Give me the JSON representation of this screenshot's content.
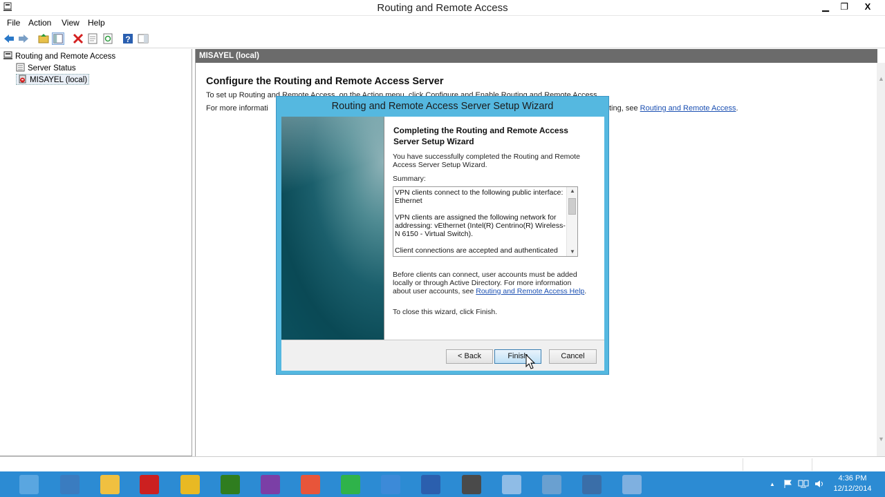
{
  "window": {
    "title": "Routing and Remote Access",
    "minimize": "▁",
    "maximize": "❐",
    "close": "X"
  },
  "menu": [
    "File",
    "Action",
    "View",
    "Help"
  ],
  "tree": {
    "root": "Routing and Remote Access",
    "items": [
      "Server Status",
      "MISAYEL (local)"
    ]
  },
  "main": {
    "header": "MISAYEL (local)",
    "heading": "Configure the Routing and Remote Access Server",
    "line1": "To set up Routing and Remote Access, on the Action menu, click Configure and Enable Routing and Remote Access.",
    "line2_prefix": "For more informati",
    "line2_suffix": "ting, see",
    "line2_link": "Routing and Remote Access",
    "line2_end": "."
  },
  "wizard": {
    "title": "Routing and Remote Access Server Setup Wizard",
    "heading": "Completing the Routing and Remote Access Server Setup Wizard",
    "intro": "You have successfully completed the Routing and Remote Access Server Setup Wizard.",
    "summary_label": "Summary:",
    "summary": [
      "VPN clients connect to the following public interface: Ethernet",
      "VPN clients are assigned the following network for addressing: vEthernet (Intel(R) Centrino(R) Wireless-N 6150 - Virtual Switch).",
      "Client connections are accepted and authenticated"
    ],
    "before_text": "Before clients can connect, user accounts must be added locally or through Active Directory. For more information about user accounts, see",
    "help_link": "Routing and Remote Access Help",
    "close_text": "To close this wizard, click Finish.",
    "back_button": "< Back",
    "finish_button": "Finish",
    "cancel_button": "Cancel"
  },
  "taskbar": {
    "apps": [
      {
        "name": "server-manager",
        "color": "#5aa6e0"
      },
      {
        "name": "powershell",
        "color": "#3a7cc0"
      },
      {
        "name": "file-explorer",
        "color": "#f0c040"
      },
      {
        "name": "unknown-app",
        "color": "#cc2020"
      },
      {
        "name": "chrome",
        "color": "#e8b923"
      },
      {
        "name": "dreamweaver",
        "color": "#2f7d1f"
      },
      {
        "name": "onenote",
        "color": "#7b3fa6"
      },
      {
        "name": "picasa",
        "color": "#e8553a"
      },
      {
        "name": "spotify",
        "color": "#2fb34a"
      },
      {
        "name": "network-globe",
        "color": "#3c8ad8"
      },
      {
        "name": "word",
        "color": "#2b5fae"
      },
      {
        "name": "media-app",
        "color": "#4a4a4a"
      },
      {
        "name": "remote-desktop",
        "color": "#8fbce6"
      },
      {
        "name": "network-tool",
        "color": "#6aa0d0"
      },
      {
        "name": "routing-app",
        "color": "#3a6ea8"
      },
      {
        "name": "admin-tool",
        "color": "#7fb0e0"
      }
    ],
    "tray_arrow": "▲",
    "time": "4:36 PM",
    "date": "12/12/2014"
  },
  "colors": {
    "taskbar": "#2c8bd3",
    "wizard_frame": "#55b8e0",
    "pane_header": "#6b6b6b"
  }
}
